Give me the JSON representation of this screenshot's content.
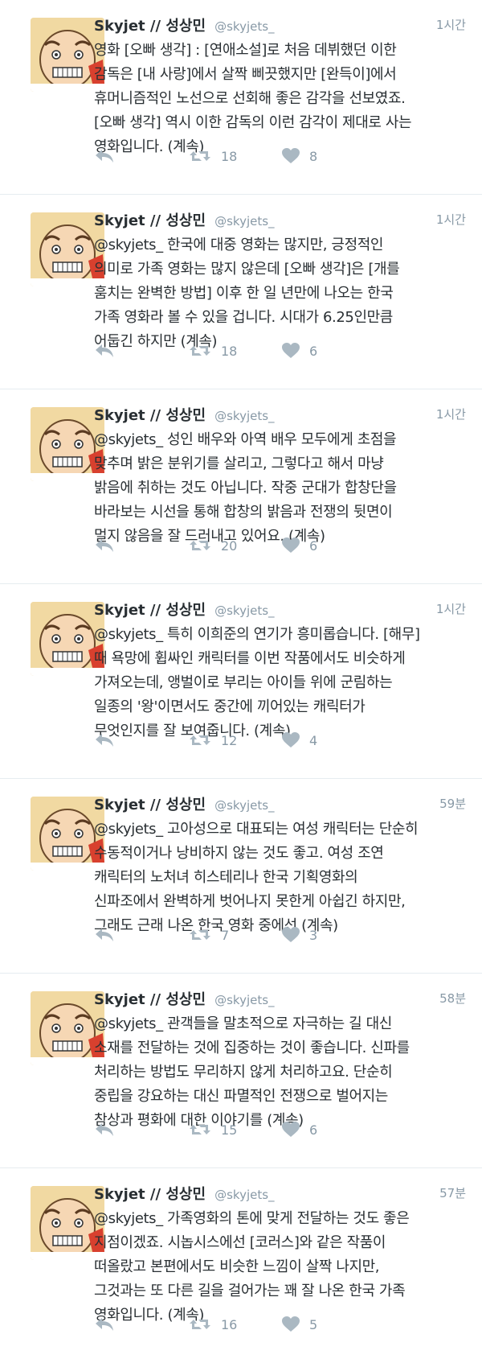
{
  "colors": {
    "text": "#292f33",
    "meta": "#8899a6",
    "icon": "#aab8c2",
    "divider": "#e6ecf0"
  },
  "icons": {
    "avatar": "cartoon-face-avatar",
    "reply": "reply-arrow-icon",
    "retweet": "retweet-icon",
    "like": "heart-icon"
  },
  "tweets": [
    {
      "name": "Skyjet // 성상민",
      "handle": "@skyjets_",
      "time": "1시간",
      "text": "영화 [오빠 생각] : [연애소설]로 처음 데뷔했던 이한\n감독은 [내 사랑]에서 살짝 삐끗했지만 [완득이]에서\n휴머니즘적인 노선으로 선회해 좋은 감각을 선보였죠.\n[오빠 생각] 역시 이한 감독의 이런 감각이 제대로 사는\n영화입니다. (계속)",
      "retweets": "18",
      "likes": "8"
    },
    {
      "name": "Skyjet // 성상민",
      "handle": "@skyjets_",
      "time": "1시간",
      "text": "@skyjets_ 한국에 대중 영화는 많지만, 긍정적인\n의미로 가족 영화는 많지 않은데 [오빠 생각]은 [개를\n훔치는 완벽한 방법] 이후 한 일 년만에 나오는 한국\n가족 영화라 볼 수 있을 겁니다. 시대가 6.25인만큼\n어둡긴 하지만 (계속)",
      "retweets": "18",
      "likes": "6"
    },
    {
      "name": "Skyjet // 성상민",
      "handle": "@skyjets_",
      "time": "1시간",
      "text": "@skyjets_ 성인 배우와 아역 배우 모두에게 초점을\n맞추며 밝은 분위기를 살리고, 그렇다고 해서 마냥\n밝음에 취하는 것도 아닙니다. 작중 군대가 합창단을\n바라보는 시선을 통해 합창의 밝음과 전쟁의 뒷면이\n멀지 않음을 잘 드러내고 있어요. (계속)",
      "retweets": "20",
      "likes": "6"
    },
    {
      "name": "Skyjet // 성상민",
      "handle": "@skyjets_",
      "time": "1시간",
      "text": "@skyjets_ 특히 이희준의 연기가 흥미롭습니다. [해무]\n때 욕망에 휩싸인 캐릭터를 이번 작품에서도 비슷하게\n가져오는데, 앵벌이로 부리는 아이들 위에 군림하는\n일종의 '왕'이면서도 중간에 끼어있는 캐릭터가\n무엇인지를 잘 보여줍니다. (계속)",
      "retweets": "12",
      "likes": "4"
    },
    {
      "name": "Skyjet // 성상민",
      "handle": "@skyjets_",
      "time": "59분",
      "text": "@skyjets_ 고아성으로 대표되는 여성 캐릭터는 단순히\n수동적이거나 낭비하지 않는 것도 좋고. 여성 조연\n캐릭터의 노처녀 히스테리나 한국 기획영화의\n신파조에서 완벽하게 벗어나지 못한게 아쉽긴 하지만,\n그래도 근래 나온 한국 영화 중에선 (계속)",
      "retweets": "7",
      "likes": "3"
    },
    {
      "name": "Skyjet // 성상민",
      "handle": "@skyjets_",
      "time": "58분",
      "text": "@skyjets_ 관객들을 말초적으로 자극하는 길 대신\n소재를 전달하는 것에 집중하는 것이 좋습니다. 신파를\n처리하는 방법도 무리하지 않게 처리하고요. 단순히\n중립을 강요하는 대신 파멸적인 전쟁으로 벌어지는\n참상과 평화에 대한 이야기를 (계속)",
      "retweets": "15",
      "likes": "6"
    },
    {
      "name": "Skyjet // 성상민",
      "handle": "@skyjets_",
      "time": "57분",
      "text": "@skyjets_ 가족영화의 톤에 맞게 전달하는 것도 좋은\n지점이겠죠. 시놉시스에선 [코러스]와 같은 작품이\n떠올랐고 본편에서도 비슷한 느낌이 살짝 나지만,\n그것과는 또 다른 길을 걸어가는 꽤 잘 나온 한국 가족\n영화입니다. (계속)",
      "retweets": "16",
      "likes": "5"
    }
  ]
}
